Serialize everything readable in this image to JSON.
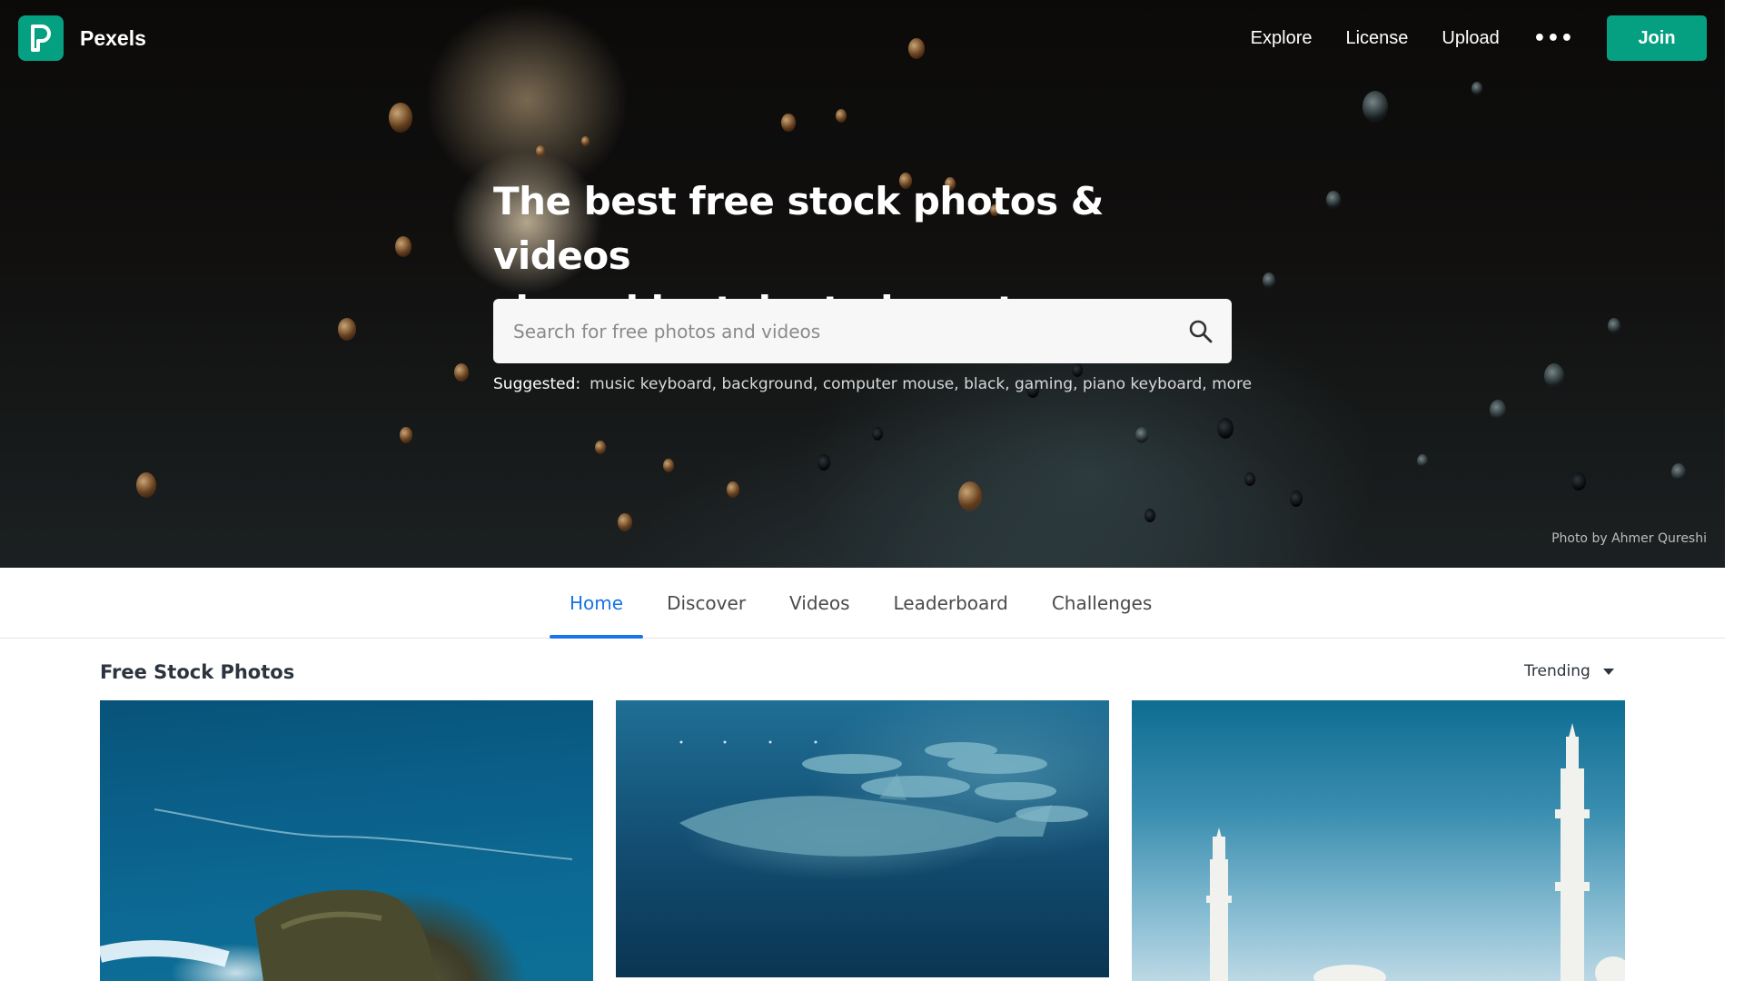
{
  "brand": {
    "name": "Pexels",
    "logo_letter": "P",
    "accent_color": "#05a081"
  },
  "nav": {
    "links": [
      "Explore",
      "License",
      "Upload"
    ],
    "more_icon": "ellipsis-icon",
    "join_label": "Join"
  },
  "hero": {
    "title_line1": "The best free stock photos & videos",
    "title_line2": "shared by talented creators.",
    "search": {
      "placeholder": "Search for free photos and videos",
      "value": "",
      "icon": "search-icon"
    },
    "suggested": {
      "label": "Suggested:",
      "items": [
        "music keyboard",
        "background",
        "computer mouse",
        "black",
        "gaming",
        "piano keyboard",
        "more"
      ]
    },
    "photo_credit": "Photo by Ahmer Qureshi"
  },
  "tabs": {
    "items": [
      "Home",
      "Discover",
      "Videos",
      "Leaderboard",
      "Challenges"
    ],
    "active": "Home",
    "active_color": "#1a73e8"
  },
  "section": {
    "title": "Free Stock Photos",
    "sort_value": "Trending"
  }
}
